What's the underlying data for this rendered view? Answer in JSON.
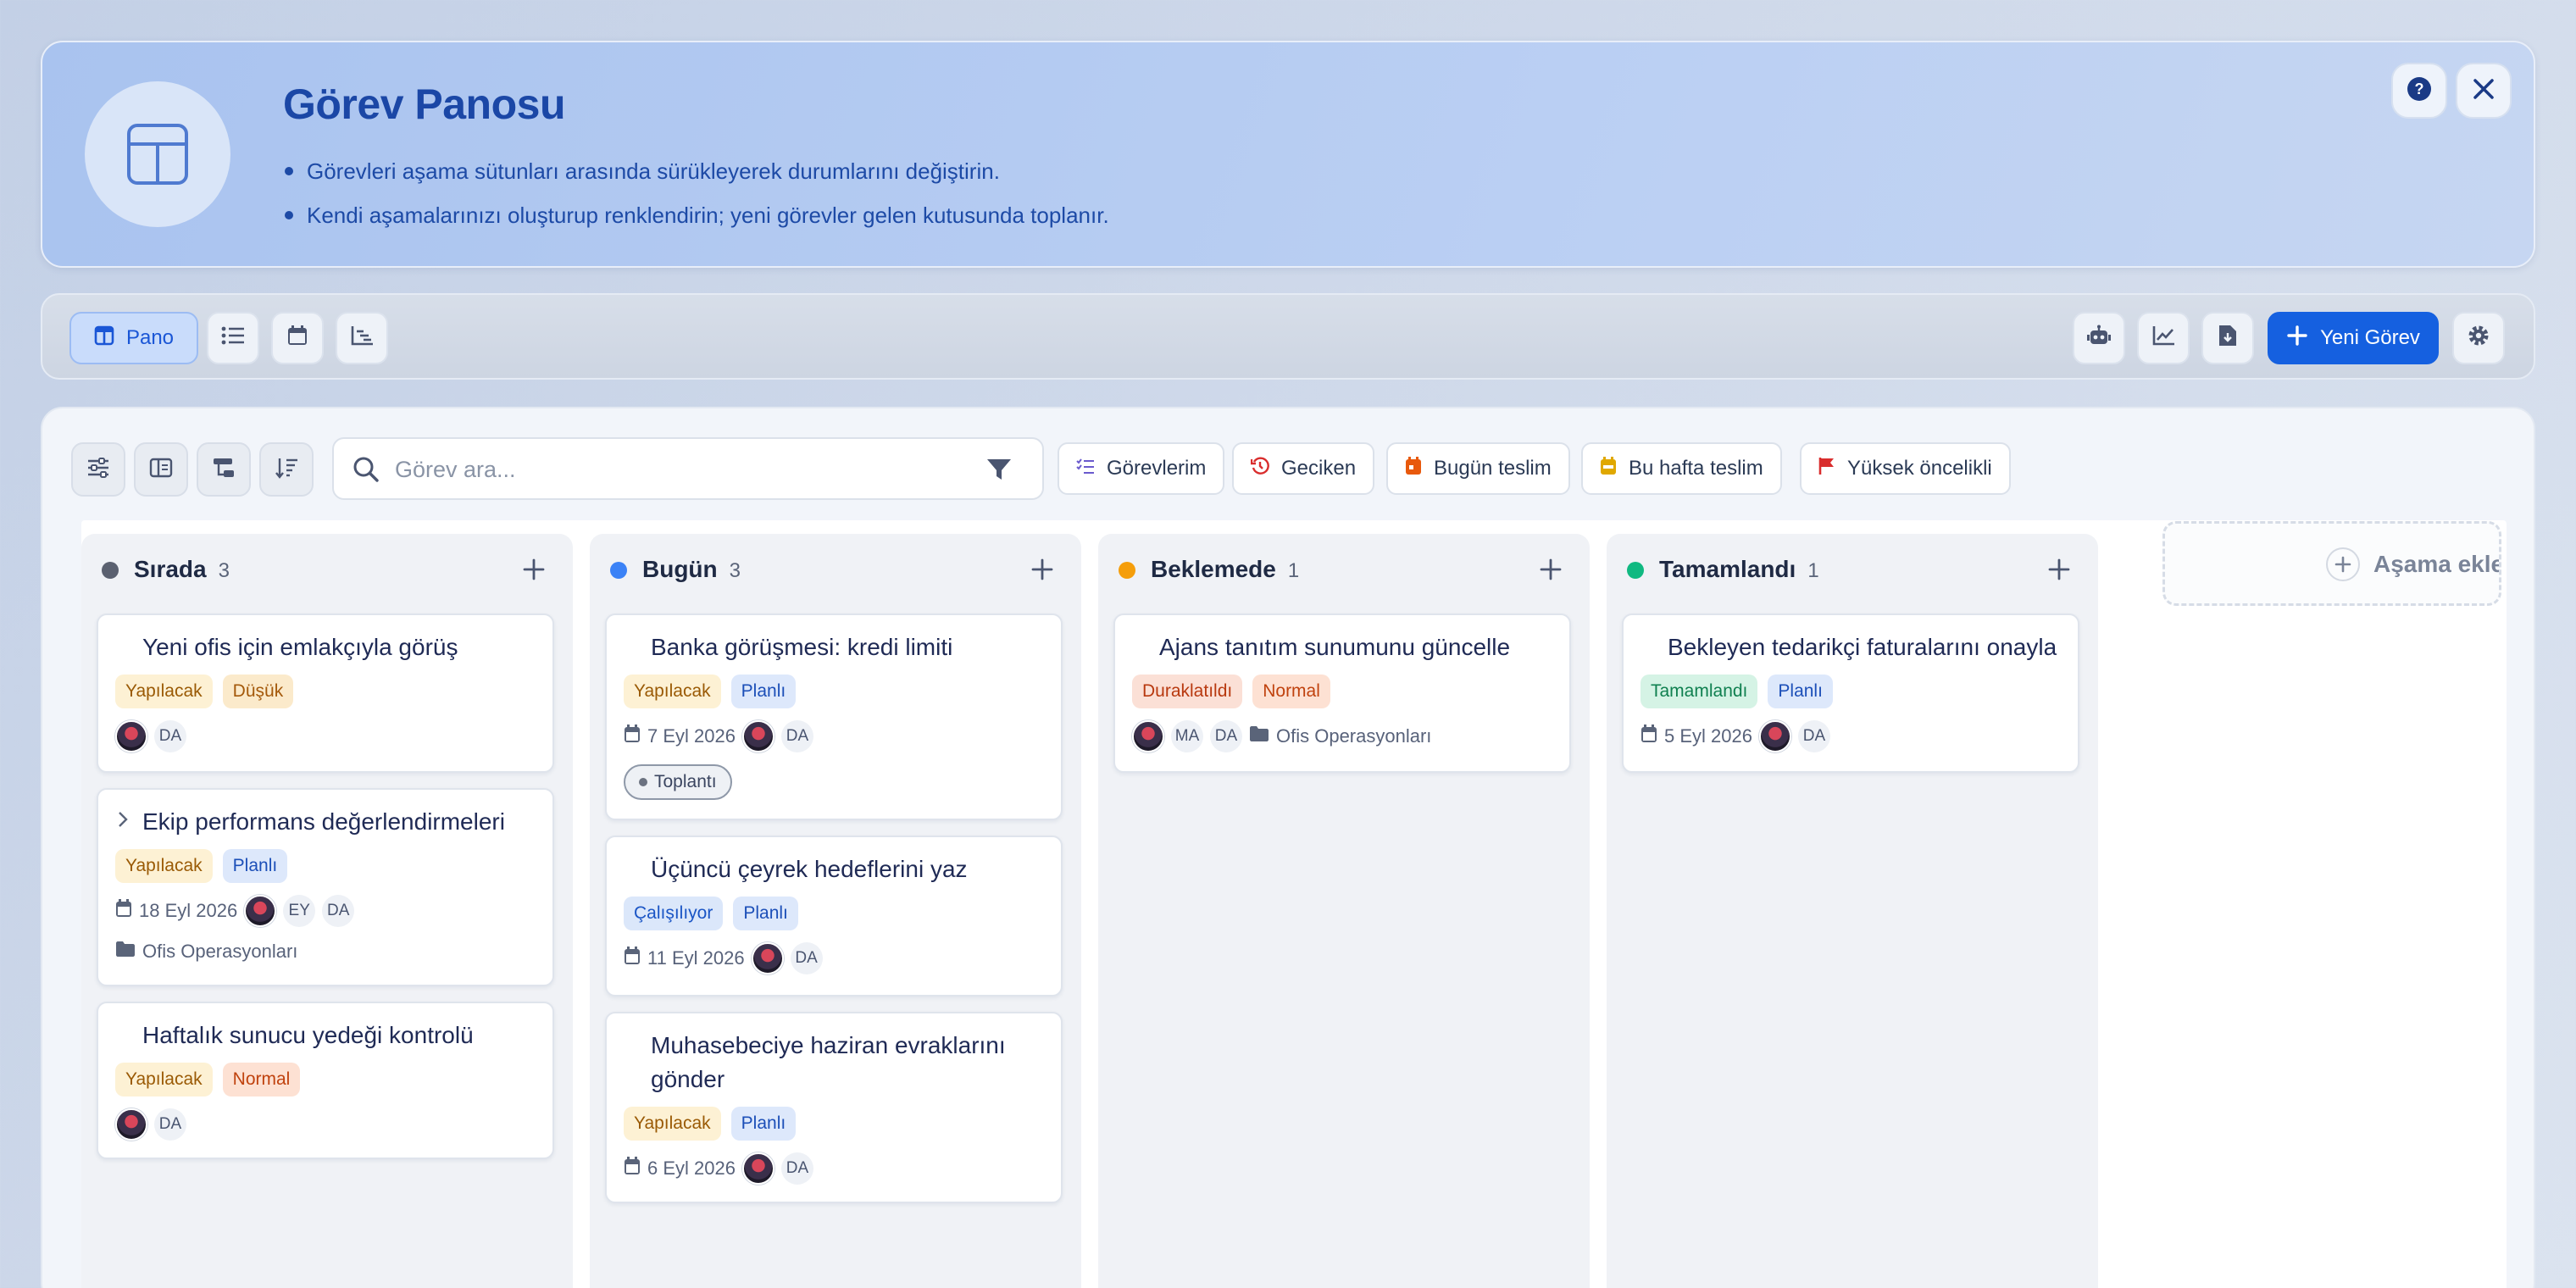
{
  "hero": {
    "title": "Görev Panosu",
    "bullets": [
      "Görevleri aşama sütunları arasında sürükleyerek durumlarını değiştirin.",
      "Kendi aşamalarınızı oluşturup renklendirin; yeni görevler gelen kutusunda toplanır."
    ],
    "help_icon": "question-circle-icon",
    "close_icon": "close-icon"
  },
  "toolbar": {
    "board_label": "Pano",
    "new_task_label": "Yeni Görev",
    "view_icons": [
      "board-icon",
      "list-icon",
      "calendar-icon",
      "gantt-icon"
    ],
    "right_icons": [
      "robot-icon",
      "chart-line-icon",
      "file-download-icon",
      "gear-icon"
    ]
  },
  "filters": {
    "search_placeholder": "Görev ara...",
    "chips": [
      "Görevlerim",
      "Geciken",
      "Bugün teslim",
      "Bu hafta teslim",
      "Yüksek öncelikli"
    ],
    "chip_colors": [
      "#6a5acd",
      "#d92d2d",
      "#e8590c",
      "#e0a800",
      "#d92d2d"
    ]
  },
  "columns": [
    {
      "title": "Sırada",
      "count": "3",
      "color": "#6b7280",
      "cards": [
        {
          "title": "Yeni ofis için emlakçıyla görüş",
          "badges": [
            "Yapılacak",
            "Düşük"
          ],
          "initials": [
            "DA"
          ]
        },
        {
          "title": "Ekip performans değerlendirmeleri",
          "badges": [
            "Yapılacak",
            "Planlı"
          ],
          "date": "18 Eyl 2026",
          "initials": [
            "EY",
            "DA"
          ],
          "folder": "Ofis Operasyonları"
        },
        {
          "title": "Haftalık sunucu yedeği kontrolü",
          "badges": [
            "Yapılacak",
            "Normal"
          ],
          "initials": [
            "DA"
          ]
        }
      ]
    },
    {
      "title": "Bugün",
      "count": "3",
      "color": "#3b82f6",
      "cards": [
        {
          "title": "Banka görüşmesi: kredi limiti",
          "badges": [
            "Yapılacak",
            "Planlı"
          ],
          "date": "7 Eyl 2026",
          "initials": [
            "DA"
          ],
          "tag": "Toplantı"
        },
        {
          "title": "Üçüncü çeyrek hedeflerini yaz",
          "badges": [
            "Çalışılıyor",
            "Planlı"
          ],
          "date": "11 Eyl 2026",
          "initials": [
            "DA"
          ]
        },
        {
          "title_line1": "Muhasebeciye haziran evraklarını",
          "title_line2": "gönder",
          "badges": [
            "Yapılacak",
            "Planlı"
          ],
          "date": "6 Eyl 2026",
          "initials": [
            "DA"
          ]
        }
      ]
    },
    {
      "title": "Beklemede",
      "count": "1",
      "color": "#f59e0b",
      "cards": [
        {
          "title": "Ajans tanıtım sunumunu güncelle",
          "badges": [
            "Duraklatıldı",
            "Normal"
          ],
          "initials": [
            "MA",
            "DA"
          ],
          "folder": "Ofis Operasyonları"
        }
      ]
    },
    {
      "title": "Tamamlandı",
      "count": "1",
      "color": "#10b981",
      "cards": [
        {
          "title": "Bekleyen tedarikçi faturalarını onayla",
          "badges": [
            "Tamamlandı",
            "Planlı"
          ],
          "date": "5 Eyl 2026",
          "initials": [
            "DA"
          ]
        }
      ]
    }
  ],
  "add_stage_label": "Aşama ekle"
}
